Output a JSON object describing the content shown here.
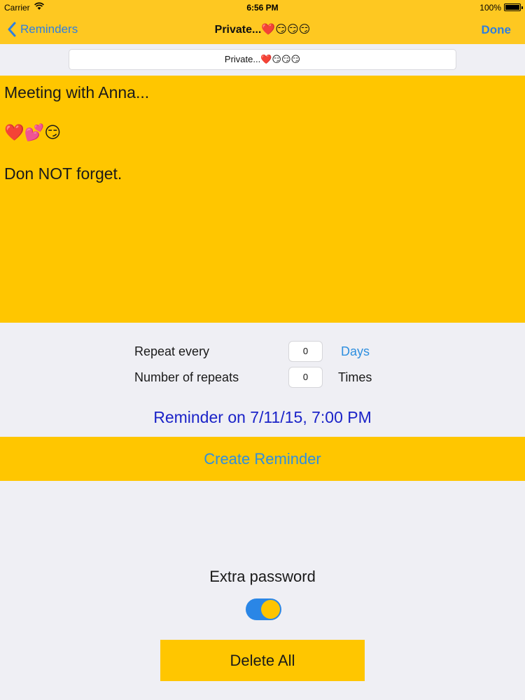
{
  "status_bar": {
    "carrier": "Carrier",
    "time": "6:56 PM",
    "battery": "100%"
  },
  "nav": {
    "back_label": "Reminders",
    "title": "Private...❤️😏😏😏",
    "done_label": "Done"
  },
  "note": {
    "title_field_value": "Private...❤️😏😏😏",
    "lines": [
      "Meeting with Anna...",
      "❤️💕😏",
      "Don NOT forget."
    ]
  },
  "repeat": {
    "repeat_every_label": "Repeat every",
    "repeat_every_value": "0",
    "repeat_every_unit": "Days",
    "num_repeats_label": "Number of repeats",
    "num_repeats_value": "0",
    "num_repeats_unit": "Times"
  },
  "reminder_date": "Reminder on 7/11/15, 7:00 PM",
  "create_button_label": "Create Reminder",
  "extra_password": {
    "label": "Extra password",
    "enabled": true
  },
  "delete_button_label": "Delete All",
  "colors": {
    "bar_yellow": "#fec821",
    "accent_yellow": "#ffc600",
    "link_blue": "#2e8fdf",
    "date_blue": "#1b23c8",
    "toggle_blue": "#2a86e6"
  }
}
